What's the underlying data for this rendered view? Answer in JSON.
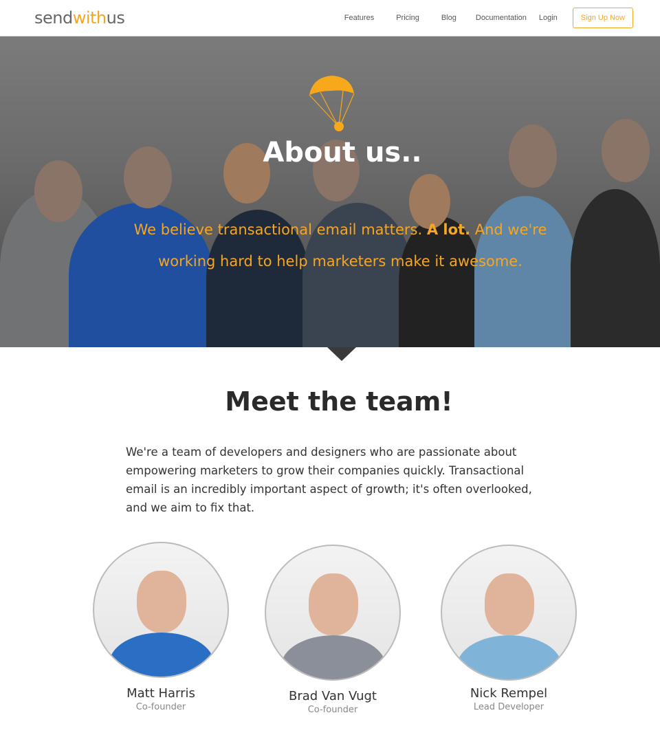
{
  "nav": {
    "logo_a": "send",
    "logo_b": "with",
    "logo_c": "us",
    "links": [
      "Features",
      "Pricing",
      "Blog",
      "Documentation",
      "Login"
    ],
    "signup": "Sign Up Now"
  },
  "hero": {
    "title": "About us..",
    "sub_a": "We believe transactional email matters. ",
    "sub_bold": "A lot.",
    "sub_b": " And we're working hard to help marketers make it awesome.",
    "icon": "parachute-icon"
  },
  "team": {
    "title": "Meet the team!",
    "intro": "We're a team of developers and designers who are passionate about empowering marketers to grow their companies quickly. Transactional email is an incredibly important aspect of growth; it's often overlooked, and we aim to fix that.",
    "members": [
      {
        "name": "Matt Harris",
        "role": "Co-founder",
        "shirt": "#2a6fc4"
      },
      {
        "name": "Brad Van Vugt",
        "role": "Co-founder",
        "shirt": "#8a8f99"
      },
      {
        "name": "Nick Rempel",
        "role": "Lead Developer",
        "shirt": "#7fb4d8"
      }
    ]
  },
  "colors": {
    "accent": "#f5a623"
  }
}
